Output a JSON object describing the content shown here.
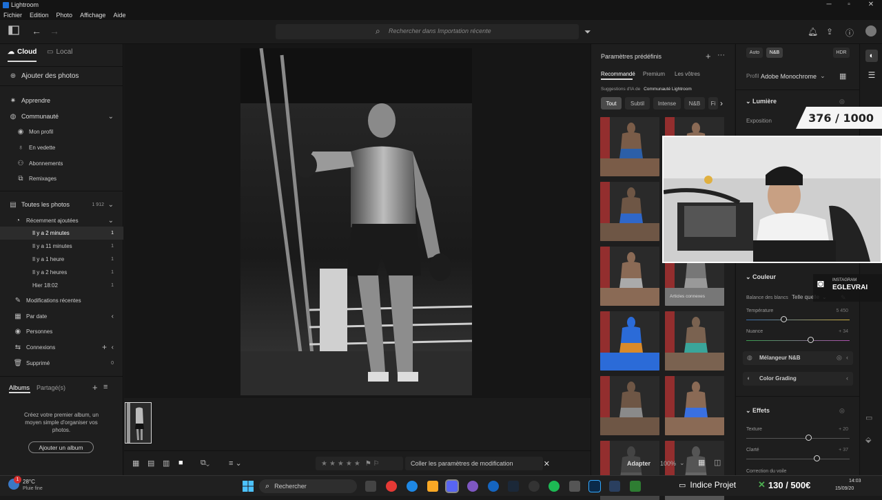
{
  "window": {
    "title": "Lightroom"
  },
  "menu": [
    "Fichier",
    "Edition",
    "Photo",
    "Affichage",
    "Aide"
  ],
  "search": {
    "placeholder": "Rechercher dans Importation récente"
  },
  "left": {
    "tabs": {
      "cloud": "Cloud",
      "local": "Local"
    },
    "add_photos": "Ajouter des photos",
    "learn": "Apprendre",
    "community": "Communauté",
    "community_items": [
      "Mon profil",
      "En vedette",
      "Abonnements",
      "Remixages"
    ],
    "all_photos": {
      "label": "Toutes les photos",
      "count": "1 912"
    },
    "recent": "Récemment ajoutées",
    "recent_items": [
      {
        "label": "Il y a 2 minutes",
        "count": "1"
      },
      {
        "label": "Il y a 11 minutes",
        "count": "1"
      },
      {
        "label": "Il y a 1 heure",
        "count": "1"
      },
      {
        "label": "Il y a 2 heures",
        "count": "1"
      },
      {
        "label": "Hier 18:02",
        "count": "1"
      }
    ],
    "recent_edits": "Modifications récentes",
    "by_date": "Par date",
    "people": "Personnes",
    "connections": "Connexions",
    "deleted": {
      "label": "Supprimé",
      "count": "0"
    },
    "albums_tab": "Albums",
    "shared_tab": "Partagé(s)",
    "album_empty": "Créez votre premier album, un moyen simple d'organiser vos photos.",
    "add_album": "Ajouter un album"
  },
  "bottom": {
    "paste": "Coller les paramètres de modification",
    "fit": "Adapter",
    "zoom": "100%"
  },
  "presets": {
    "title": "Paramètres prédéfinis",
    "tabs": [
      "Recommandé",
      "Premium",
      "Les vôtres"
    ],
    "ai_label": "Suggestions d'IA de",
    "ai_source": "Communauté Lightroom",
    "chips": [
      "Tout",
      "Subtil",
      "Intense",
      "N&B",
      "Fi"
    ],
    "overlay_label": "Articles connexes"
  },
  "edit": {
    "modes": [
      "Auto",
      "N&B",
      "HDR"
    ],
    "profile_label": "Profil",
    "profile_value": "Adobe Monochrome",
    "light": "Lumière",
    "exposure": "Exposition",
    "color": "Couleur",
    "wb_label": "Balance des blancs",
    "wb_value": "Telle quelle",
    "temperature": {
      "label": "Température",
      "value": "5 450",
      "pos": 0.36
    },
    "tint": {
      "label": "Nuance",
      "value": "+ 34",
      "pos": 0.62
    },
    "bw_mixer": "Mélangeur N&B",
    "color_grading": "Color Grading",
    "effects": "Effets",
    "texture": {
      "label": "Texture",
      "value": "+ 20",
      "pos": 0.6
    },
    "clarity": {
      "label": "Clarté",
      "value": "+ 37",
      "pos": 0.68
    },
    "dehaze": "Correction du voile"
  },
  "overlays": {
    "counter": "376 / 1000",
    "insta_top": "INSTAGRAM",
    "insta_handle": "EGLEVRAI"
  },
  "taskbar": {
    "temp": "28°C",
    "weather": "Pluie fine",
    "search": "Rechercher",
    "notif": "1",
    "indice": "Indice Projet",
    "score": "130 / 500€",
    "time": "14:03",
    "date": "15/09/20"
  }
}
